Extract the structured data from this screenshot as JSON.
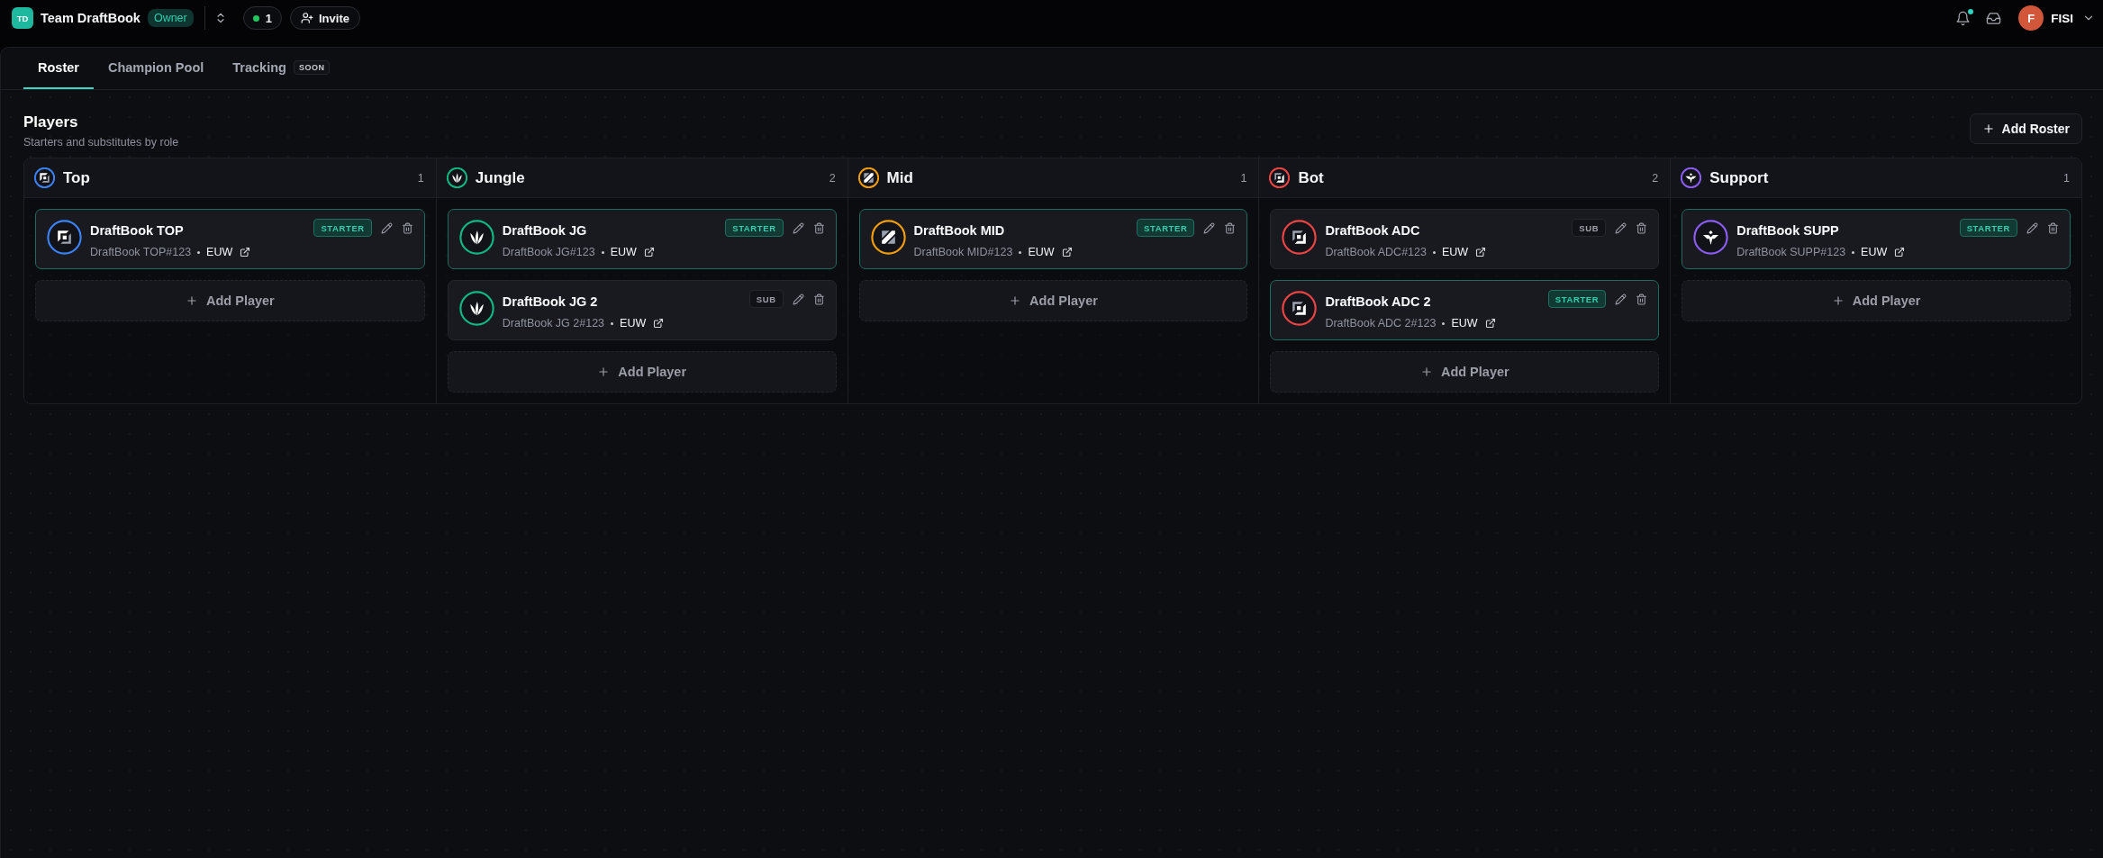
{
  "topbar": {
    "team_initials": "TD",
    "team_name": "Team DraftBook",
    "team_role": "Owner",
    "online_count": "1",
    "invite_label": "Invite",
    "notifications_unread": true,
    "user_initial": "F",
    "user_name": "FISI"
  },
  "tabs": [
    {
      "label": "Roster",
      "selected": true
    },
    {
      "label": "Champion Pool",
      "selected": false
    },
    {
      "label": "Tracking",
      "selected": false,
      "badge": "SOON"
    }
  ],
  "section": {
    "title": "Players",
    "subtitle": "Starters and substitutes by role",
    "add_roster_label": "Add Roster"
  },
  "roles": [
    {
      "name": "Top",
      "kind": "top",
      "color": "#3b82f6",
      "count": "1",
      "players": [
        {
          "name": "DraftBook TOP",
          "riot_id": "DraftBook TOP#123",
          "region": "EUW",
          "status": "STARTER",
          "starter": true
        }
      ],
      "add_label": "Add Player"
    },
    {
      "name": "Jungle",
      "kind": "jungle",
      "color": "#10b981",
      "count": "2",
      "players": [
        {
          "name": "DraftBook JG",
          "riot_id": "DraftBook JG#123",
          "region": "EUW",
          "status": "STARTER",
          "starter": true
        },
        {
          "name": "DraftBook JG 2",
          "riot_id": "DraftBook JG 2#123",
          "region": "EUW",
          "status": "SUB",
          "starter": false
        }
      ],
      "add_label": "Add Player"
    },
    {
      "name": "Mid",
      "kind": "mid",
      "color": "#f59e0b",
      "count": "1",
      "players": [
        {
          "name": "DraftBook MID",
          "riot_id": "DraftBook MID#123",
          "region": "EUW",
          "status": "STARTER",
          "starter": true
        }
      ],
      "add_label": "Add Player"
    },
    {
      "name": "Bot",
      "kind": "bot",
      "color": "#ef4444",
      "count": "2",
      "players": [
        {
          "name": "DraftBook ADC",
          "riot_id": "DraftBook ADC#123",
          "region": "EUW",
          "status": "SUB",
          "starter": false
        },
        {
          "name": "DraftBook ADC 2",
          "riot_id": "DraftBook ADC 2#123",
          "region": "EUW",
          "status": "STARTER",
          "starter": true
        }
      ],
      "add_label": "Add Player"
    },
    {
      "name": "Support",
      "kind": "support",
      "color": "#8b5cf6",
      "count": "1",
      "players": [
        {
          "name": "DraftBook SUPP",
          "riot_id": "DraftBook SUPP#123",
          "region": "EUW",
          "status": "STARTER",
          "starter": true
        }
      ],
      "add_label": "Add Player"
    }
  ]
}
